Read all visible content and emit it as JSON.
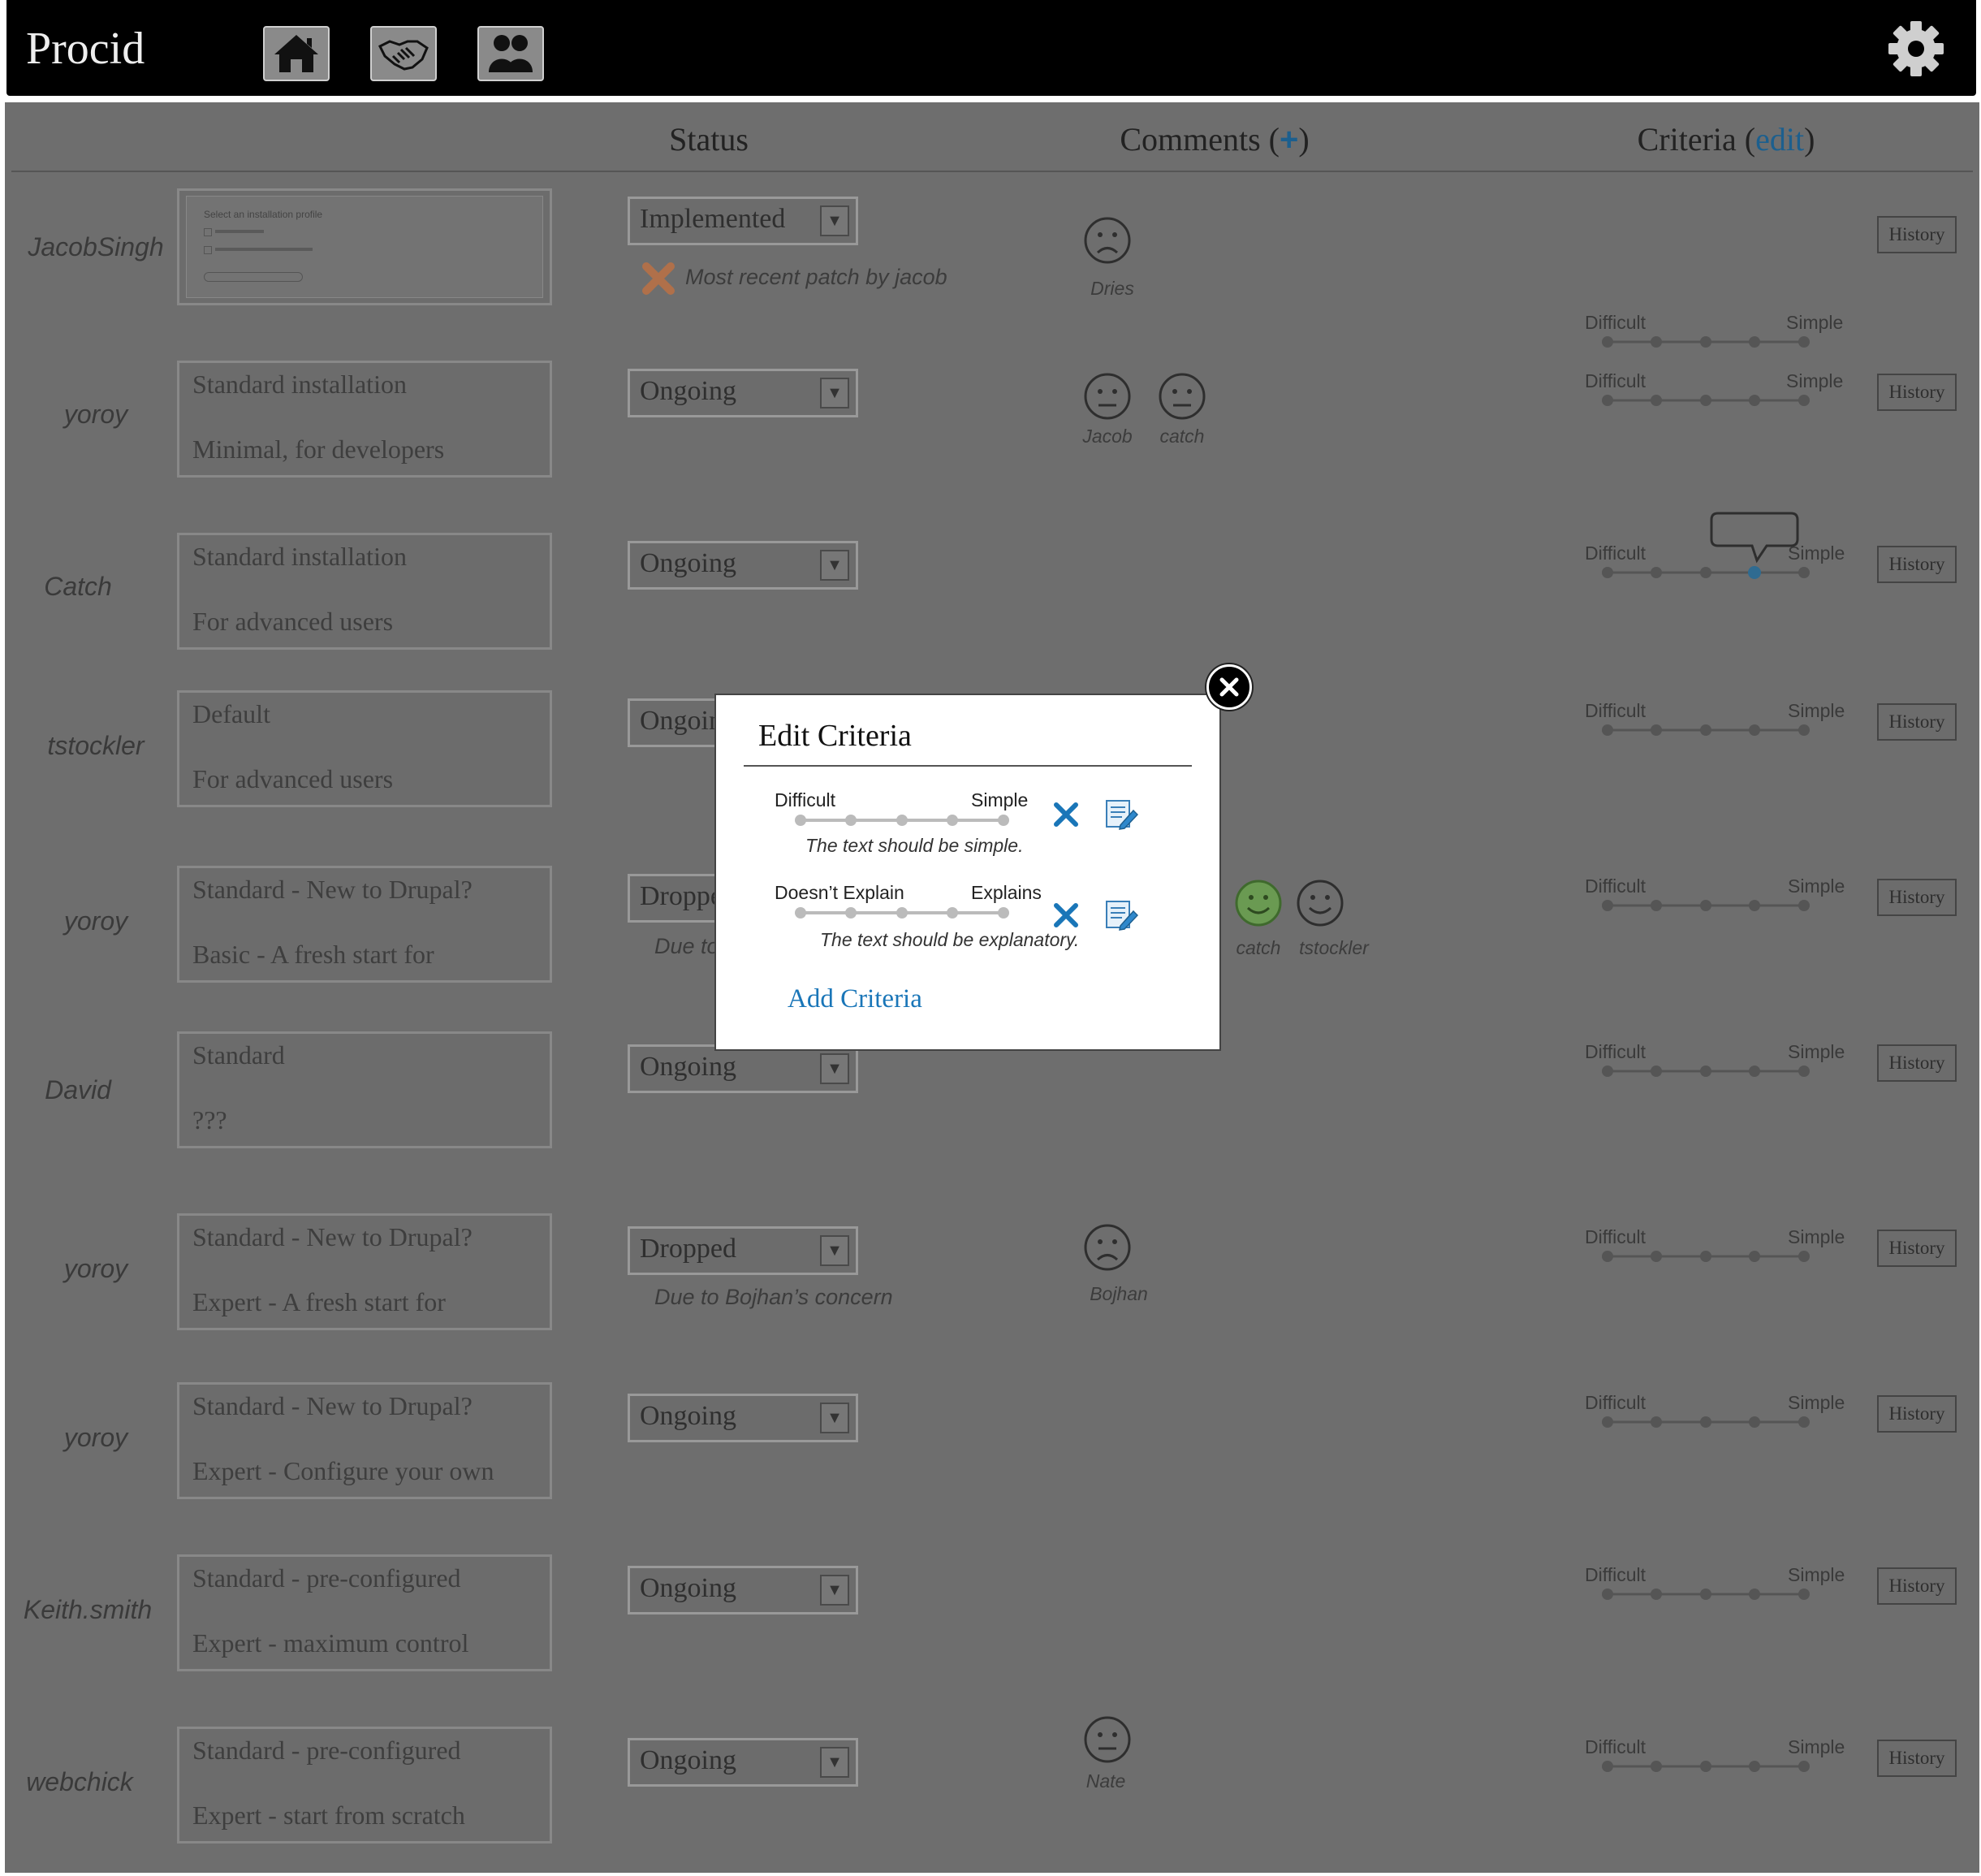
{
  "app": {
    "title": "Procid"
  },
  "nav": {
    "icons": [
      "home-icon",
      "handshake-icon",
      "people-icon",
      "gear-icon"
    ]
  },
  "columns": {
    "status": "Status",
    "comments": "Comments",
    "comments_plus": "+",
    "criteria": "Criteria",
    "criteria_edit": "edit"
  },
  "rows": [
    {
      "author": "JacobSingh",
      "desc": {
        "line1": "Select an installation profile",
        "line2": ""
      },
      "status": "Implemented",
      "note": "Most recent patch by jacob",
      "comments": [
        {
          "name": "Dries",
          "mood": "sad"
        }
      ],
      "criteria": {
        "left": "Difficult",
        "right": "Simple"
      },
      "history": "History"
    },
    {
      "author": "yoroy",
      "desc": {
        "line1": "Standard installation",
        "line2": "Minimal, for developers"
      },
      "status": "Ongoing",
      "note": "",
      "comments": [
        {
          "name": "Jacob",
          "mood": "neutral"
        },
        {
          "name": "catch",
          "mood": "neutral"
        }
      ],
      "criteria": {
        "left": "Difficult",
        "right": "Simple"
      },
      "history": "History"
    },
    {
      "author": "Catch",
      "desc": {
        "line1": "Standard installation",
        "line2": "For advanced users"
      },
      "status": "Ongoing",
      "note": "",
      "comments": [],
      "criteria": {
        "left": "Difficult",
        "right": "Simple"
      },
      "history": "History"
    },
    {
      "author": "tstockler",
      "desc": {
        "line1": "Default",
        "line2": "For advanced users"
      },
      "status": "Ongoing",
      "note": "",
      "comments": [],
      "criteria": {
        "left": "Difficult",
        "right": "Simple"
      },
      "history": "History"
    },
    {
      "author": "yoroy",
      "desc": {
        "line1": "Standard - New to Drupal?",
        "line2": "Basic - A fresh start for"
      },
      "status": "Dropped",
      "note": "Due to",
      "comments": [
        {
          "name": "catch",
          "mood": "happy"
        },
        {
          "name": "tstockler",
          "mood": "happy"
        }
      ],
      "criteria": {
        "left": "Difficult",
        "right": "Simple"
      },
      "history": "History"
    },
    {
      "author": "David",
      "desc": {
        "line1": "Standard",
        "line2": "???"
      },
      "status": "Ongoing",
      "note": "",
      "comments": [],
      "criteria": {
        "left": "Difficult",
        "right": "Simple"
      },
      "history": "History"
    },
    {
      "author": "yoroy",
      "desc": {
        "line1": "Standard - New to Drupal?",
        "line2": "Expert - A fresh start for"
      },
      "status": "Dropped",
      "note": "Due to Bojhan’s concern",
      "comments": [
        {
          "name": "Bojhan",
          "mood": "sad"
        }
      ],
      "criteria": {
        "left": "Difficult",
        "right": "Simple"
      },
      "history": "History"
    },
    {
      "author": "yoroy",
      "desc": {
        "line1": "Standard - New to Drupal?",
        "line2": "Expert - Configure your own"
      },
      "status": "Ongoing",
      "note": "",
      "comments": [],
      "criteria": {
        "left": "Difficult",
        "right": "Simple"
      },
      "history": "History"
    },
    {
      "author": "Keith.smith",
      "desc": {
        "line1": "Standard - pre-configured",
        "line2": "Expert - maximum control"
      },
      "status": "Ongoing",
      "note": "",
      "comments": [],
      "criteria": {
        "left": "Difficult",
        "right": "Simple"
      },
      "history": "History"
    },
    {
      "author": "webchick",
      "desc": {
        "line1": "Standard - pre-configured",
        "line2": "Expert - start from scratch"
      },
      "status": "Ongoing",
      "note": "",
      "comments": [
        {
          "name": "Nate",
          "mood": "neutral"
        }
      ],
      "criteria": {
        "left": "Difficult",
        "right": "Simple"
      },
      "history": "History"
    }
  ],
  "modal": {
    "title": "Edit Criteria",
    "criteria": [
      {
        "left": "Difficult",
        "right": "Simple",
        "text": "The text should be simple."
      },
      {
        "left": "Doesn’t Explain",
        "right": "Explains",
        "text": "The text should be explanatory."
      }
    ],
    "add_label": "Add Criteria"
  },
  "colors": {
    "accent": "#1a76b8",
    "overlay": "#6e6e6e",
    "happy": "#6a9a52",
    "reject": "#b0704a"
  }
}
